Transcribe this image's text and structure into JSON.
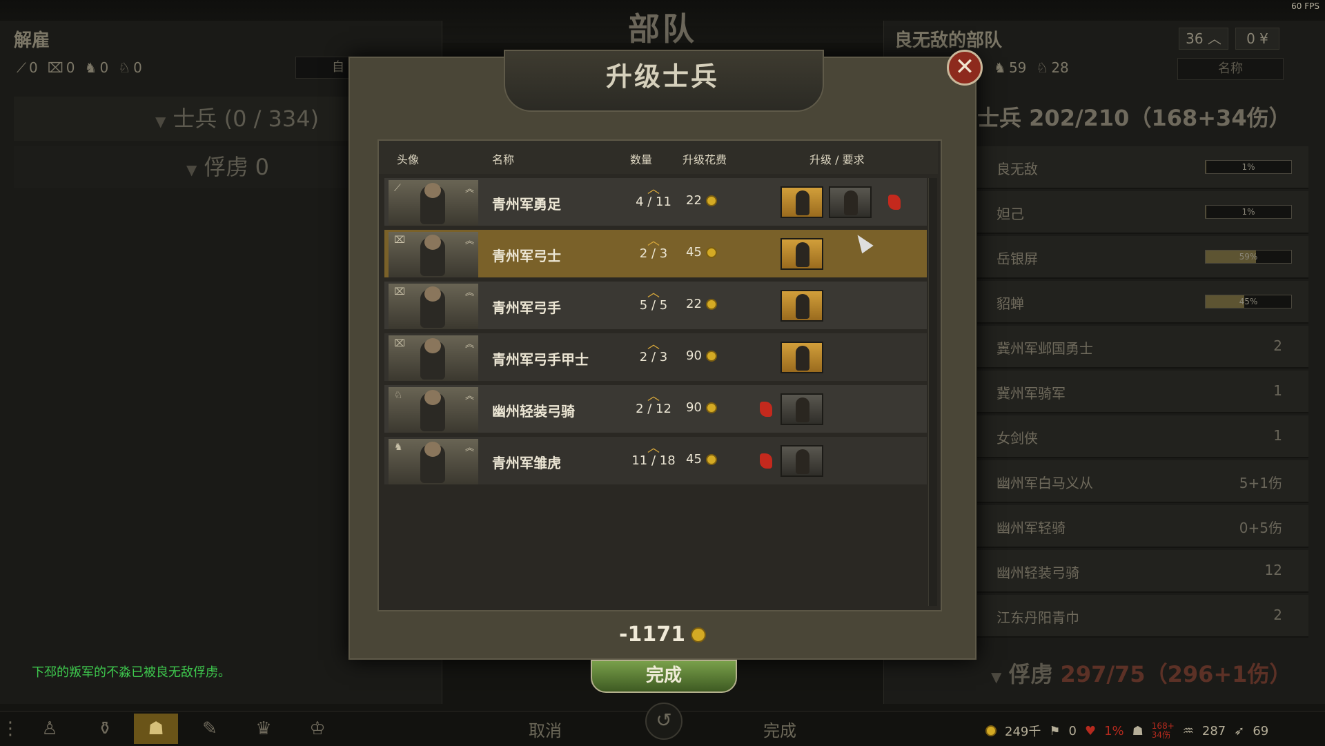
{
  "fps": "60 FPS",
  "screen_title": "部队",
  "left": {
    "title": "解雇",
    "counts": [
      {
        "icon": "spear-icon",
        "glyph": "⟋",
        "value": "0"
      },
      {
        "icon": "bow-icon",
        "glyph": "⌧",
        "value": "0"
      },
      {
        "icon": "horse-icon",
        "glyph": "♞",
        "value": "0"
      },
      {
        "icon": "horse-archer-icon",
        "glyph": "♘",
        "value": "0"
      }
    ],
    "dropdown": "自",
    "soldiers_label": "士兵",
    "soldiers_count": "(0 / 334)",
    "prisoners_label": "俘虏",
    "prisoners_count": "0"
  },
  "right": {
    "title": "良无敌的部队",
    "num1": "36",
    "num2": "0",
    "counts": [
      {
        "icon": "horse-icon",
        "glyph": "♞",
        "value": "59"
      },
      {
        "icon": "horse-archer-icon",
        "glyph": "♘",
        "value": "28"
      }
    ],
    "sort_label": "名称",
    "soldiers_label": "士兵",
    "soldiers_count": "202/210",
    "soldiers_detail": "（168+34伤）",
    "rows": [
      {
        "name": "良无敌",
        "bar": 0.01,
        "pct": "1%"
      },
      {
        "name": "妲己",
        "bar": 0.01,
        "pct": "1%"
      },
      {
        "name": "岳银屏",
        "bar": 0.59,
        "pct": "59%"
      },
      {
        "name": "貂蝉",
        "bar": 0.45,
        "pct": "45%"
      },
      {
        "name": "冀州军邺国勇士",
        "value": "2"
      },
      {
        "name": "冀州军骑军",
        "value": "1"
      },
      {
        "name": "女剑侠",
        "value": "1"
      },
      {
        "name": "幽州军白马义从",
        "value": "5+1伤"
      },
      {
        "name": "幽州军轻骑",
        "value": "0+5伤"
      },
      {
        "name": "幽州轻装弓骑",
        "value": "12"
      },
      {
        "name": "江东丹阳青巾",
        "value": "2"
      }
    ],
    "prisoners_label": "俘虏",
    "prisoners_count": "297/75",
    "prisoners_detail": "（296+1伤）"
  },
  "modal": {
    "title": "升级士兵",
    "headers": {
      "portrait": "头像",
      "name": "名称",
      "qty": "数量",
      "cost": "升级花费",
      "upgrade": "升级 / 要求"
    },
    "rows": [
      {
        "name": "青州军勇足",
        "qty": "4 / 11",
        "cost": "22",
        "class_glyph": "⟋",
        "options": [
          "gold",
          "gray"
        ],
        "req_after": true,
        "selected": false
      },
      {
        "name": "青州军弓士",
        "qty": "2 / 3",
        "cost": "45",
        "class_glyph": "⌧",
        "options": [
          "gold"
        ],
        "req_after": false,
        "selected": true
      },
      {
        "name": "青州军弓手",
        "qty": "5 / 5",
        "cost": "22",
        "class_glyph": "⌧",
        "options": [
          "gold"
        ],
        "req_after": false,
        "selected": false
      },
      {
        "name": "青州军弓手甲士",
        "qty": "2 / 3",
        "cost": "90",
        "class_glyph": "⌧",
        "options": [
          "gold"
        ],
        "req_after": false,
        "selected": false
      },
      {
        "name": "幽州轻装弓骑",
        "qty": "2 / 12",
        "cost": "90",
        "class_glyph": "♘",
        "options": [
          "gray"
        ],
        "req_before": true,
        "selected": false
      },
      {
        "name": "青州军雏虎",
        "qty": "11 / 18",
        "cost": "45",
        "class_glyph": "♞",
        "options": [
          "gray"
        ],
        "req_before": true,
        "selected": false
      }
    ],
    "total": "-1171",
    "done_label": "完成"
  },
  "bottom": {
    "cancel_label": "取消",
    "done_label": "完成",
    "stats": {
      "gold": "249千",
      "influence": "0",
      "morale": "1%",
      "troops_top": "168+",
      "troops_bottom": "34伤",
      "food": "287",
      "speed": "69"
    }
  },
  "notification": "下邳的叛军的不淼已被良无敌俘虏。"
}
